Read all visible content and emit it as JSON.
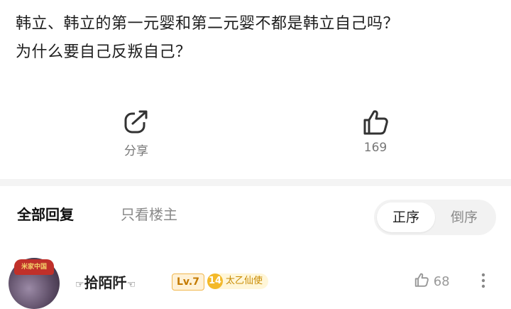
{
  "post": {
    "line1": "韩立、韩立的第一元婴和第二元婴不都是韩立自己吗？",
    "line2": "为什么要自己反叛自己？"
  },
  "actions": {
    "share_label": "分享",
    "like_count": "169"
  },
  "reply_tabs": {
    "all": "全部回复",
    "op_only": "只看楼主"
  },
  "sort": {
    "ascending": "正序",
    "descending": "倒序",
    "selected": "正序"
  },
  "reply": {
    "avatar_frame_text": "米家中国",
    "username": "拾陌阡",
    "level": "Lv.7",
    "title_number": "14",
    "title_name": "太乙仙使",
    "like_count": "68"
  },
  "colors": {
    "muted_text": "#777777",
    "level_badge": "#f0b74d",
    "divider": "#f4f4f4"
  },
  "icons": {
    "share": "share-pen-icon",
    "like": "thumbs-up-icon",
    "more": "more-vertical-icon"
  }
}
